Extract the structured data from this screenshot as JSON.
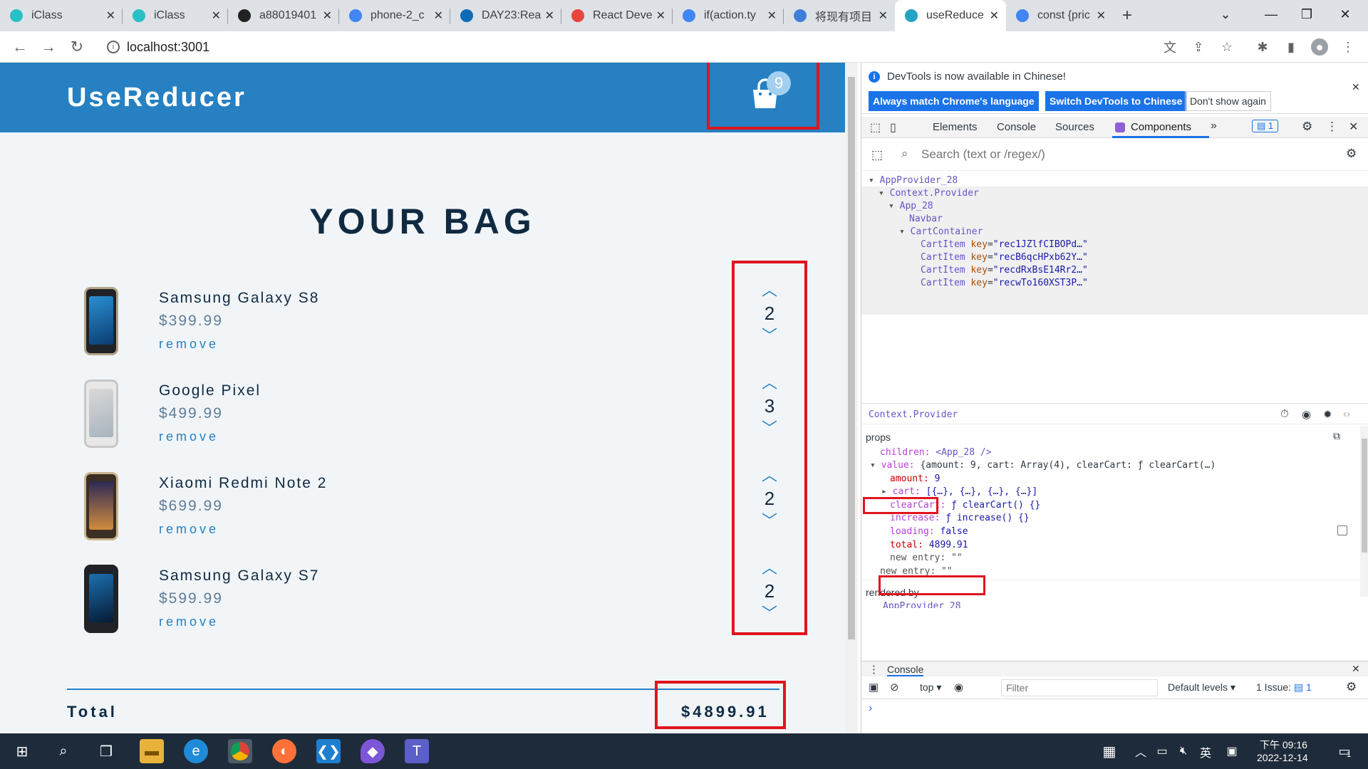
{
  "browser": {
    "tabs": [
      {
        "label": "iClass",
        "favicon": "iclass-icon",
        "color": "#28c0c6"
      },
      {
        "label": "iClass",
        "favicon": "iclass-icon",
        "color": "#28c0c6"
      },
      {
        "label": "a88019401",
        "favicon": "github-icon",
        "color": "#222222"
      },
      {
        "label": "phone-2_c",
        "favicon": "google-icon",
        "color": "#4285f4"
      },
      {
        "label": "DAY23:Rea",
        "favicon": "ithome-icon",
        "color": "#0a6bb8"
      },
      {
        "label": "React Deve",
        "favicon": "chrome-icon",
        "color": "#e8453c"
      },
      {
        "label": "if(action.ty",
        "favicon": "google-icon",
        "color": "#4285f4"
      },
      {
        "label": "将现有项目",
        "favicon": "cloud-icon",
        "color": "#3f7fd8"
      },
      {
        "label": "useReduce",
        "favicon": "react-icon",
        "color": "#23a4c4",
        "active": true
      },
      {
        "label": "const {pric",
        "favicon": "google-icon",
        "color": "#4285f4"
      }
    ],
    "url": "localhost:3001"
  },
  "app": {
    "brand": "UseReducer",
    "cart_count": "9",
    "bag_title": "YOUR BAG",
    "remove_label": "remove",
    "items": [
      {
        "name": "Samsung Galaxy S8",
        "price": "$399.99",
        "amount": "2"
      },
      {
        "name": "Google Pixel",
        "price": "$499.99",
        "amount": "3"
      },
      {
        "name": "Xiaomi Redmi Note 2",
        "price": "$699.99",
        "amount": "2"
      },
      {
        "name": "Samsung Galaxy S7",
        "price": "$599.99",
        "amount": "2"
      }
    ],
    "total_label": "Total",
    "total_value": "$4899.91"
  },
  "devtools": {
    "banner": "DevTools is now available in Chinese!",
    "btn_match": "Always match Chrome's language",
    "btn_switch": "Switch DevTools to Chinese",
    "btn_dont": "Don't show again",
    "tabs": [
      "Elements",
      "Console",
      "Sources",
      "Components"
    ],
    "issues_badge": "1",
    "search_placeholder": "Search (text or /regex/)",
    "tree": [
      {
        "label": "AppProvider_28"
      },
      {
        "label": "Context.Provider"
      },
      {
        "label": "App_28"
      },
      {
        "label": "Navbar"
      },
      {
        "label": "CartContainer"
      },
      {
        "label": "CartItem",
        "key": "\"rec1JZlfCIBOPd…\""
      },
      {
        "label": "CartItem",
        "key": "\"recB6qcHPxb62Y…\""
      },
      {
        "label": "CartItem",
        "key": "\"recdRxBsE14Rr2…\""
      },
      {
        "label": "CartItem",
        "key": "\"recwTo160XST3P…\""
      }
    ],
    "key_label": "key",
    "selected": "Context.Provider",
    "props_label": "props",
    "props": {
      "children_k": "children:",
      "children_v": "<App_28 />",
      "value_k": "value:",
      "value_v": "{amount: 9, cart: Array(4), clearCart: ƒ clearCart(…)",
      "amount_k": "amount:",
      "amount_v": "9",
      "cart_k": "cart:",
      "cart_v": "[{…}, {…}, {…}, {…}]",
      "clear_k": "clearCart:",
      "clear_v": "ƒ clearCart() {}",
      "inc_k": "increase:",
      "inc_v": "ƒ increase() {}",
      "load_k": "loading:",
      "load_v": "false",
      "total_k": "total:",
      "total_v": "4899.91",
      "ne1_k": "new entry:",
      "ne1_v": "\"\"",
      "ne2_k": "new entry:",
      "ne2_v": "\"\""
    },
    "rendered_by_label": "rendered by",
    "rendered_by": "AppProvider_28",
    "console_tab": "Console",
    "console_context": "top",
    "filter_placeholder": "Filter",
    "default_levels": "Default levels",
    "issue_count_label": "1 Issue:",
    "issue_count": "1",
    "prompt": "›"
  },
  "taskbar": {
    "time": "下午 09:16",
    "date": "2022-12-14",
    "ime": "英",
    "notif": "1"
  },
  "colors": {
    "accent": "#2680c2",
    "highlight": "#e0141e",
    "dark": "#102a42"
  }
}
